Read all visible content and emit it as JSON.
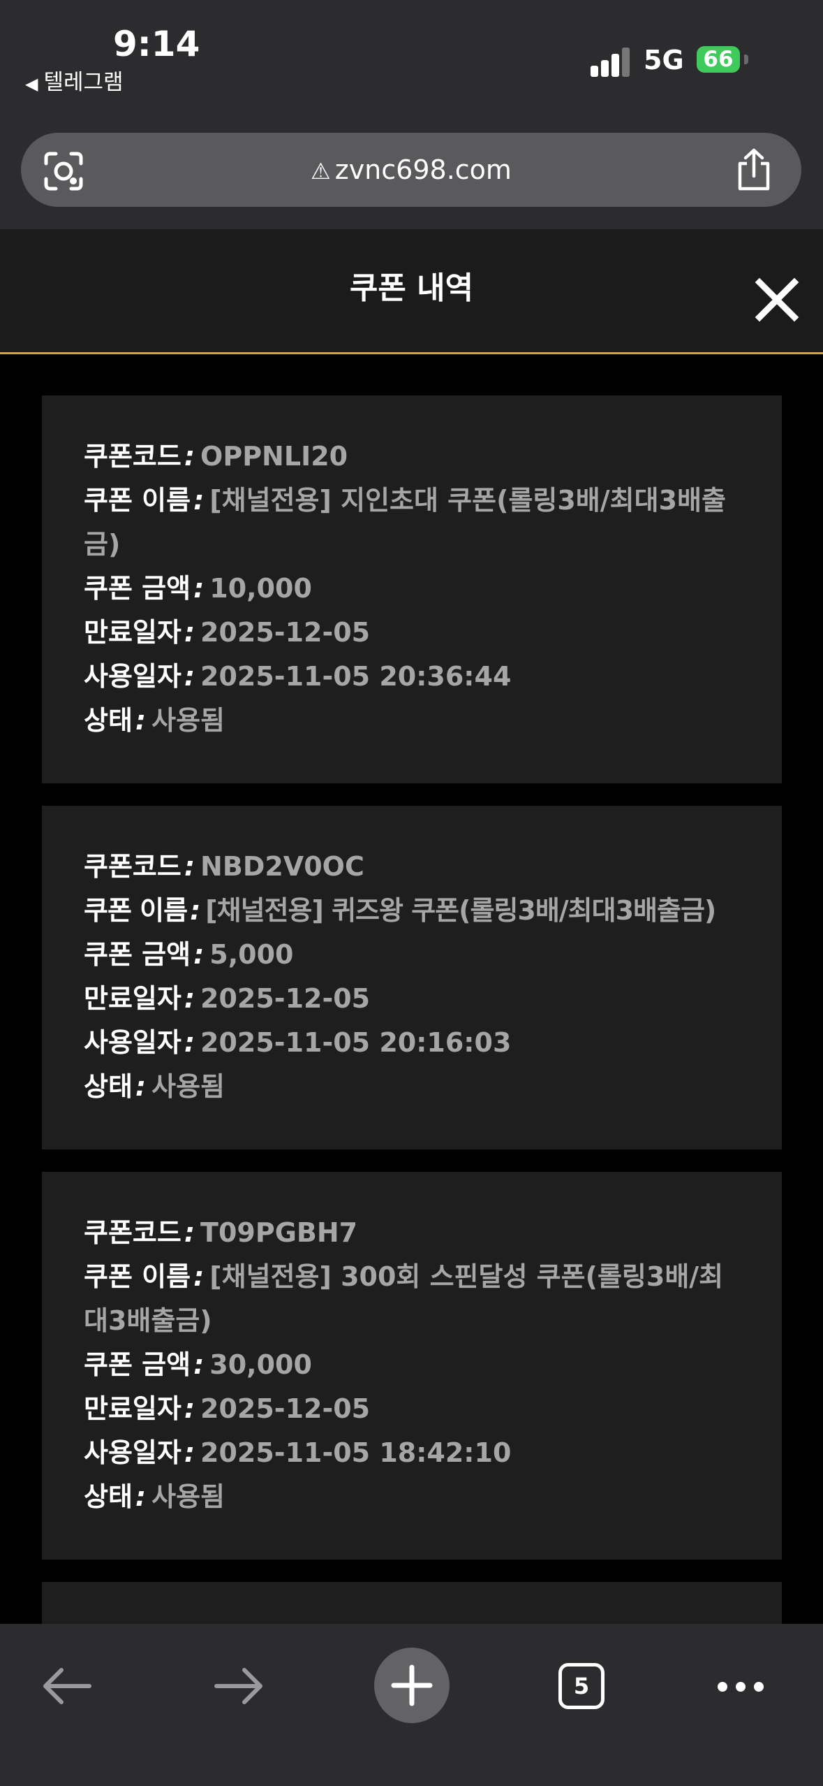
{
  "status_bar": {
    "time": "9:14",
    "back_app": "텔레그램",
    "network": "5G",
    "battery": "66"
  },
  "browser": {
    "url": "zvnc698.com",
    "tab_count": "5"
  },
  "header": {
    "title": "쿠폰 내역"
  },
  "labels": {
    "code": "쿠폰코드",
    "name": "쿠폰 이름",
    "amount": "쿠폰 금액",
    "expiry": "만료일자",
    "used": "사용일자",
    "status": "상태",
    "sep": ":"
  },
  "coupons": [
    {
      "code": "OPPNLI20",
      "name": "[채널전용] 지인초대 쿠폰(롤링3배/최대3배출금)",
      "amount": "10,000",
      "expiry": "2025-12-05",
      "used": "2025-11-05 20:36:44",
      "status": "사용됨"
    },
    {
      "code": "NBD2V0OC",
      "name": "[채널전용] 퀴즈왕 쿠폰(롤링3배/최대3배출금)",
      "amount": "5,000",
      "expiry": "2025-12-05",
      "used": "2025-11-05 20:16:03",
      "status": "사용됨"
    },
    {
      "code": "T09PGBH7",
      "name": "[채널전용] 300회 스핀달성 쿠폰(롤링3배/최대3배출금)",
      "amount": "30,000",
      "expiry": "2025-12-05",
      "used": "2025-11-05 18:42:10",
      "status": "사용됨"
    }
  ],
  "icons": {
    "lens": "camera-lens-icon",
    "warning": "warning-icon",
    "share": "share-icon",
    "close": "close-icon",
    "back": "arrow-left-icon",
    "forward": "arrow-right-icon",
    "new_tab": "plus-icon",
    "more": "more-icon"
  }
}
